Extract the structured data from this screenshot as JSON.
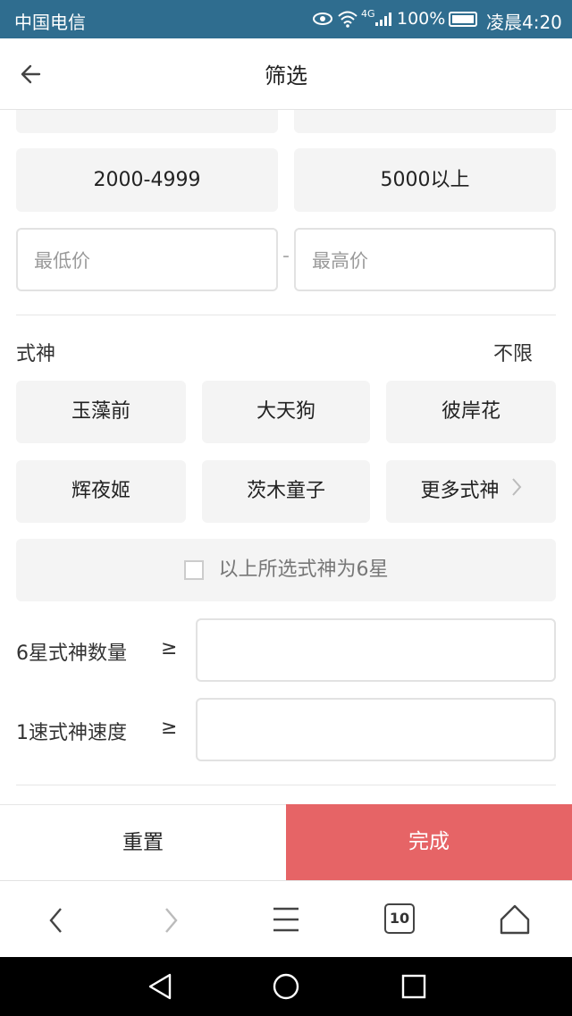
{
  "status": {
    "carrier": "中国电信",
    "network": "4G",
    "battery": "100%",
    "time": "凌晨4:20"
  },
  "header": {
    "title": "筛选"
  },
  "price": {
    "options": [
      "2000-4999",
      "5000以上"
    ],
    "min_placeholder": "最低价",
    "max_placeholder": "最高价",
    "separator": "-"
  },
  "shikigami": {
    "label": "式神",
    "unlimited": "不限",
    "options": [
      "玉藻前",
      "大天狗",
      "彼岸花",
      "辉夜姬",
      "茨木童子",
      "更多式神"
    ],
    "six_star_checkbox": "以上所选式神为6星"
  },
  "filters": {
    "six_star_count_label": "6星式神数量",
    "speed_label": "1速式神速度",
    "gte": "≥"
  },
  "actions": {
    "reset": "重置",
    "done": "完成"
  },
  "browser": {
    "tabs_count": "10"
  }
}
